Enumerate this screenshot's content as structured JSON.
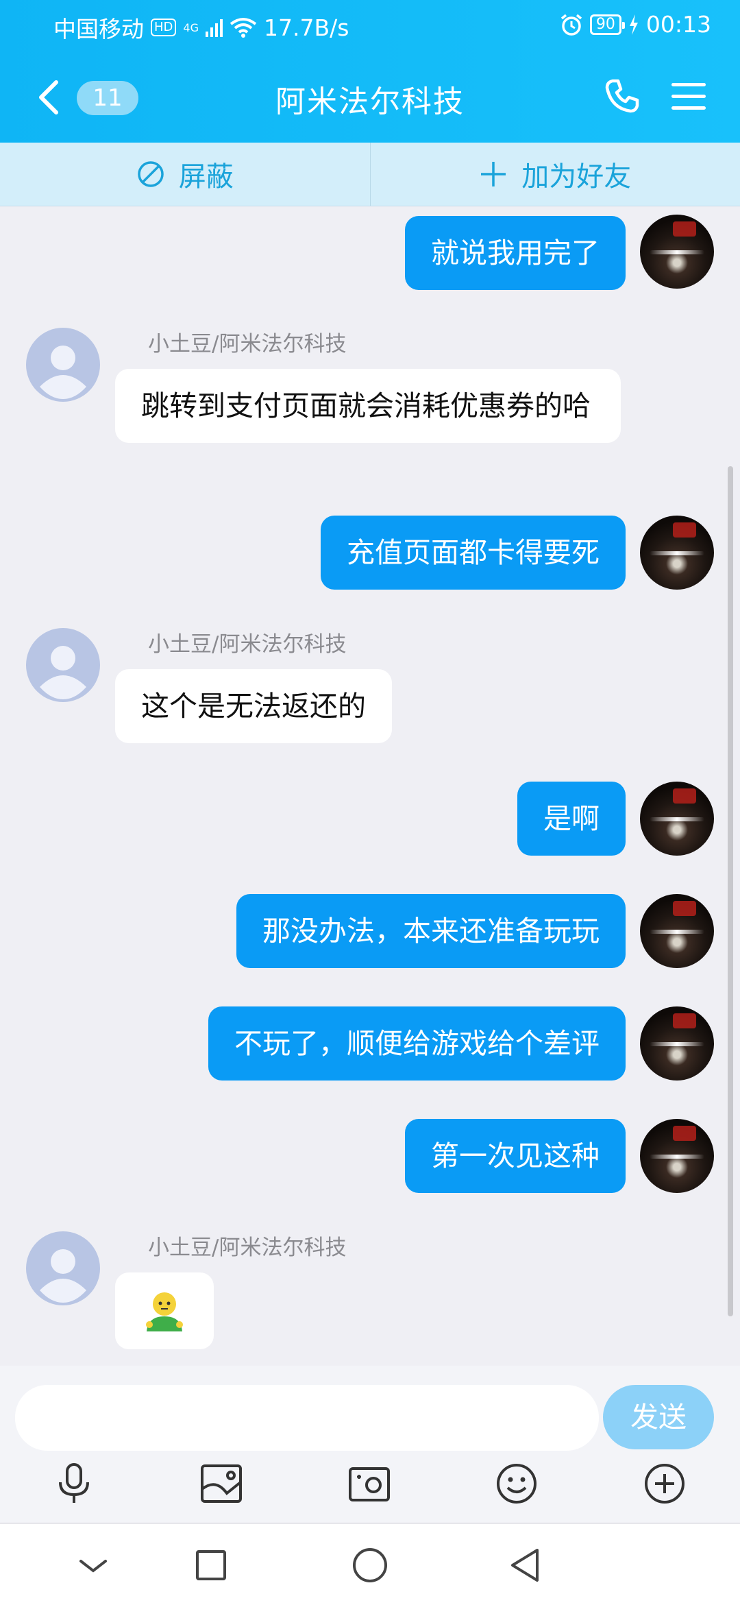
{
  "status_bar": {
    "carrier": "中国移动",
    "hd": "HD",
    "network": "4G",
    "speed": "17.7B/s",
    "battery": "90",
    "time": "00:13"
  },
  "header": {
    "unread_count": "11",
    "title": "阿米法尔科技"
  },
  "actions": {
    "block_label": "屏蔽",
    "add_friend_label": "加为好友"
  },
  "messages": [
    {
      "type": "out",
      "text": "就说我用完了"
    },
    {
      "type": "in",
      "sender": "小土豆/阿米法尔科技",
      "text": "跳转到支付页面就会消耗优惠券的哈"
    },
    {
      "type": "out",
      "text": "充值页面都卡得要死"
    },
    {
      "type": "in",
      "sender": "小土豆/阿米法尔科技",
      "text": "这个是无法返还的"
    },
    {
      "type": "out",
      "text": "是啊"
    },
    {
      "type": "out",
      "text": "那没办法，本来还准备玩玩"
    },
    {
      "type": "out",
      "text": "不玩了，顺便给游戏给个差评"
    },
    {
      "type": "out",
      "text": "第一次见这种"
    },
    {
      "type": "in",
      "sender": "小土豆/阿米法尔科技",
      "text": "",
      "sticker": "person-emoji"
    }
  ],
  "input": {
    "value": "",
    "send_label": "发送"
  },
  "colors": {
    "header": "#15bcf9",
    "bubble_out": "#0a9bf5",
    "bubble_in": "#ffffff",
    "background": "#efeff4"
  }
}
